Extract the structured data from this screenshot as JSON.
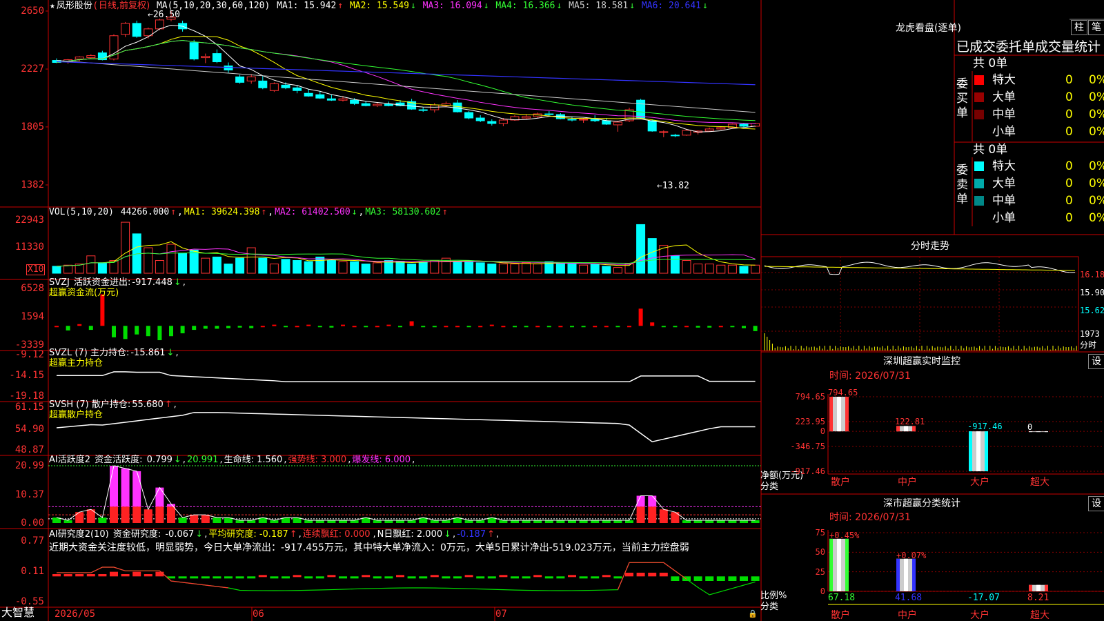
{
  "chart_data": [
    {
      "type": "candlestick",
      "title": "凤形股份",
      "period": "日线,前复权",
      "y_ticks": [
        "2650",
        "2227",
        "1805",
        "1382"
      ],
      "ylim": [
        1382,
        2650
      ],
      "annotations": [
        {
          "text": "26.50"
        },
        {
          "text": "←13.82"
        }
      ],
      "ma_header": {
        "label": "MA(5,10,20,30,60,120)",
        "items": [
          {
            "name": "MA1",
            "value": "15.942",
            "trend": "↑",
            "color": "#ffffff"
          },
          {
            "name": "MA2",
            "value": "15.549",
            "trend": "↓",
            "color": "#ffff00"
          },
          {
            "name": "MA3",
            "value": "16.094",
            "trend": "↓",
            "color": "#ff33ff"
          },
          {
            "name": "MA4",
            "value": "16.366",
            "trend": "↓",
            "color": "#33ff33"
          },
          {
            "name": "MA5",
            "value": "18.581",
            "trend": "↓",
            "color": "#cccccc"
          },
          {
            "name": "MA6",
            "value": "20.641",
            "trend": "↓",
            "color": "#3333ff"
          }
        ]
      },
      "candles": [
        {
          "o": 2290,
          "h": 2305,
          "l": 2270,
          "c": 2275
        },
        {
          "o": 2280,
          "h": 2300,
          "l": 2265,
          "c": 2295
        },
        {
          "o": 2300,
          "h": 2320,
          "l": 2285,
          "c": 2315
        },
        {
          "o": 2310,
          "h": 2335,
          "l": 2300,
          "c": 2325
        },
        {
          "o": 2345,
          "h": 2360,
          "l": 2290,
          "c": 2295
        },
        {
          "o": 2300,
          "h": 2480,
          "l": 2290,
          "c": 2470
        },
        {
          "o": 2480,
          "h": 2570,
          "l": 2460,
          "c": 2560
        },
        {
          "o": 2560,
          "h": 2580,
          "l": 2455,
          "c": 2465
        },
        {
          "o": 2470,
          "h": 2530,
          "l": 2450,
          "c": 2520
        },
        {
          "o": 2520,
          "h": 2595,
          "l": 2510,
          "c": 2585
        },
        {
          "o": 2590,
          "h": 2650,
          "l": 2575,
          "c": 2605
        },
        {
          "o": 2560,
          "h": 2580,
          "l": 2500,
          "c": 2520
        },
        {
          "o": 2420,
          "h": 2440,
          "l": 2290,
          "c": 2300
        },
        {
          "o": 2310,
          "h": 2340,
          "l": 2270,
          "c": 2320
        },
        {
          "o": 2340,
          "h": 2370,
          "l": 2270,
          "c": 2280
        },
        {
          "o": 2250,
          "h": 2275,
          "l": 2200,
          "c": 2220
        },
        {
          "o": 2170,
          "h": 2185,
          "l": 2120,
          "c": 2130
        },
        {
          "o": 2140,
          "h": 2190,
          "l": 2120,
          "c": 2170
        },
        {
          "o": 2140,
          "h": 2180,
          "l": 2080,
          "c": 2090
        },
        {
          "o": 2070,
          "h": 2130,
          "l": 2060,
          "c": 2120
        },
        {
          "o": 2110,
          "h": 2130,
          "l": 2080,
          "c": 2090
        },
        {
          "o": 2090,
          "h": 2110,
          "l": 2050,
          "c": 2070
        },
        {
          "o": 2050,
          "h": 2080,
          "l": 2025,
          "c": 2030
        },
        {
          "o": 2040,
          "h": 2065,
          "l": 2010,
          "c": 2015
        },
        {
          "o": 2010,
          "h": 2040,
          "l": 1995,
          "c": 2000
        },
        {
          "o": 2000,
          "h": 2030,
          "l": 1990,
          "c": 2010
        },
        {
          "o": 2000,
          "h": 2015,
          "l": 1965,
          "c": 1975
        },
        {
          "o": 1975,
          "h": 1995,
          "l": 1955,
          "c": 1960
        },
        {
          "o": 1960,
          "h": 1985,
          "l": 1950,
          "c": 1970
        },
        {
          "o": 1970,
          "h": 1990,
          "l": 1955,
          "c": 1960
        },
        {
          "o": 1980,
          "h": 2000,
          "l": 1955,
          "c": 1960
        },
        {
          "o": 1990,
          "h": 2010,
          "l": 1930,
          "c": 1935
        },
        {
          "o": 1930,
          "h": 1950,
          "l": 1915,
          "c": 1925
        },
        {
          "o": 1930,
          "h": 1980,
          "l": 1910,
          "c": 1965
        },
        {
          "o": 1960,
          "h": 1990,
          "l": 1950,
          "c": 1975
        },
        {
          "o": 1980,
          "h": 2000,
          "l": 1910,
          "c": 1915
        },
        {
          "o": 1910,
          "h": 1920,
          "l": 1860,
          "c": 1870
        },
        {
          "o": 1870,
          "h": 1890,
          "l": 1840,
          "c": 1850
        },
        {
          "o": 1845,
          "h": 1860,
          "l": 1815,
          "c": 1830
        },
        {
          "o": 1830,
          "h": 1870,
          "l": 1810,
          "c": 1855
        },
        {
          "o": 1855,
          "h": 1890,
          "l": 1850,
          "c": 1880
        },
        {
          "o": 1870,
          "h": 1900,
          "l": 1865,
          "c": 1880
        },
        {
          "o": 1880,
          "h": 1910,
          "l": 1870,
          "c": 1900
        },
        {
          "o": 1900,
          "h": 1920,
          "l": 1880,
          "c": 1895
        },
        {
          "o": 1895,
          "h": 1905,
          "l": 1860,
          "c": 1865
        },
        {
          "o": 1860,
          "h": 1880,
          "l": 1845,
          "c": 1855
        },
        {
          "o": 1855,
          "h": 1870,
          "l": 1835,
          "c": 1860
        },
        {
          "o": 1860,
          "h": 1890,
          "l": 1840,
          "c": 1850
        },
        {
          "o": 1850,
          "h": 1870,
          "l": 1820,
          "c": 1825
        },
        {
          "o": 1820,
          "h": 1850,
          "l": 1770,
          "c": 1840
        },
        {
          "o": 1850,
          "h": 1945,
          "l": 1840,
          "c": 1930
        },
        {
          "o": 2000,
          "h": 2010,
          "l": 1860,
          "c": 1870
        },
        {
          "o": 1850,
          "h": 1860,
          "l": 1770,
          "c": 1775
        },
        {
          "o": 1770,
          "h": 1780,
          "l": 1730,
          "c": 1770
        },
        {
          "o": 1745,
          "h": 1755,
          "l": 1730,
          "c": 1740
        },
        {
          "o": 1745,
          "h": 1790,
          "l": 1740,
          "c": 1780
        },
        {
          "o": 1765,
          "h": 1780,
          "l": 1750,
          "c": 1775
        },
        {
          "o": 1775,
          "h": 1800,
          "l": 1770,
          "c": 1790
        },
        {
          "o": 1790,
          "h": 1810,
          "l": 1785,
          "c": 1800
        },
        {
          "o": 1800,
          "h": 1830,
          "l": 1795,
          "c": 1825
        },
        {
          "o": 1825,
          "h": 1835,
          "l": 1800,
          "c": 1810
        },
        {
          "o": 1810,
          "h": 1835,
          "l": 1805,
          "c": 1830
        }
      ]
    },
    {
      "type": "bar",
      "title": "VOL(5,10,20)",
      "value": "44266.000",
      "value_trend": "↑",
      "items": [
        {
          "name": "MA1",
          "value": "39624.398",
          "trend": "↑",
          "color": "#ffff00"
        },
        {
          "name": "MA2",
          "value": "61402.500",
          "trend": "↓",
          "color": "#ff33ff"
        },
        {
          "name": "MA3",
          "value": "58130.602",
          "trend": "↑",
          "color": "#33ff33"
        }
      ],
      "y_ticks": [
        "22943",
        "11330"
      ],
      "unit": "X10",
      "ylim": [
        0,
        25000
      ],
      "values": [
        3000,
        3500,
        4000,
        7500,
        4500,
        5500,
        22000,
        17000,
        11000,
        5500,
        12500,
        8500,
        10000,
        6500,
        7000,
        4000,
        6500,
        11000,
        6500,
        4000,
        6000,
        5500,
        5000,
        7000,
        5500,
        5000,
        5000,
        4000,
        4500,
        5500,
        5000,
        4000,
        5000,
        5500,
        6500,
        5000,
        5000,
        4500,
        4000,
        4000,
        4000,
        4500,
        4000,
        5000,
        4000,
        4000,
        3500,
        4000,
        3000,
        2500,
        4000,
        21000,
        15000,
        12000,
        7500,
        5500,
        4000,
        4000,
        3500,
        3500,
        3000,
        3500
      ]
    },
    {
      "type": "bar",
      "title": "SVZJ",
      "subtitle": "活跃资金进出:",
      "value": "-917.448",
      "value_trend": "↓",
      "label2": "超赢资金流(万元)",
      "y_ticks": [
        "6528",
        "1594",
        "-3339"
      ],
      "ylim": [
        -3339,
        6528
      ],
      "values": [
        0,
        -800,
        300,
        -700,
        5500,
        -2000,
        -2300,
        -1500,
        -1800,
        -2500,
        -1800,
        -1300,
        -700,
        -500,
        -500,
        -400,
        -300,
        -400,
        0,
        200,
        -200,
        0,
        200,
        -200,
        -300,
        200,
        0,
        -200,
        0,
        200,
        -200,
        800,
        -200,
        -200,
        0,
        0,
        -200,
        0,
        200,
        0,
        -200,
        -200,
        0,
        -200,
        0,
        -200,
        -200,
        0,
        0,
        -200,
        0,
        3000,
        600,
        -200,
        -200,
        0,
        -300,
        -300,
        0,
        -200,
        -400,
        -917
      ]
    },
    {
      "type": "line",
      "title": "SVZL (7) 主力持仓:",
      "value": "-15.861",
      "value_trend": "↓",
      "label2": "超赢主力持仓",
      "y_ticks": [
        "-9.12",
        "-14.15",
        "-19.18"
      ],
      "ylim": [
        -19.18,
        -9.12
      ]
    },
    {
      "type": "line",
      "title": "SVSH (7) 散户持仓:",
      "value": "55.680",
      "value_trend": "↑",
      "label2": "超赢散户持仓",
      "y_ticks": [
        "61.15",
        "54.90",
        "48.87"
      ],
      "ylim": [
        48.87,
        61.15
      ]
    },
    {
      "type": "bar",
      "title": "AI活跃度2",
      "subtitle": "资金活跃度:",
      "value": "0.799",
      "value_trend": "↓",
      "items": [
        {
          "name": "",
          "value": "20.991",
          "trend": "",
          "color": "#33ff33"
        },
        {
          "name": "生命线",
          "value": "1.560",
          "trend": "",
          "color": "#ffffff"
        },
        {
          "name": "强势线",
          "value": "3.000",
          "trend": "",
          "color": "#ff3333"
        },
        {
          "name": "爆发线",
          "value": "6.000",
          "trend": "",
          "color": "#ff33ff"
        }
      ],
      "y_ticks": [
        "20.99",
        "10.37",
        "0.00"
      ],
      "ylim": [
        0,
        20.99
      ],
      "values": [
        2,
        1,
        4,
        5,
        2,
        21,
        20,
        19,
        5,
        13,
        7,
        2,
        3,
        3,
        2,
        2,
        1,
        1,
        2,
        1,
        2,
        2,
        1,
        1,
        1,
        1,
        1,
        2,
        1,
        1,
        1,
        1,
        2,
        1,
        1,
        2,
        1,
        1,
        2,
        1,
        1,
        1,
        1,
        1,
        1,
        1,
        1,
        1,
        1,
        1,
        1,
        10,
        10,
        5,
        4,
        1,
        1,
        1,
        1,
        1,
        1,
        1
      ]
    },
    {
      "type": "bar",
      "title": "AI研究度2(10)",
      "subtitle": "资金研究度:",
      "value": "-0.067",
      "value_trend": "↓",
      "items": [
        {
          "name": "平均研究度",
          "value": "-0.187",
          "trend": "↑",
          "color": "#ffff00"
        },
        {
          "name": "连续飘红",
          "value": "0.000",
          "trend": "",
          "color": "#ff3333"
        },
        {
          "name": "N日飘红",
          "value": "2.000",
          "trend": "↓",
          "color": "#ffffff"
        },
        {
          "name": "",
          "value": "-0.187",
          "trend": "↑",
          "color": "#3333ff"
        }
      ],
      "note": "近期大资金关注度较低，明显弱势，今日大单净流出：-917.455万元，其中特大单净流入：0万元，大单5日累计净出-519.023万元，当前主力控盘弱",
      "y_ticks": [
        "0.77",
        "0.11",
        "-0.55"
      ],
      "ylim": [
        -0.55,
        0.77
      ]
    }
  ],
  "xaxis": {
    "labels": [
      "2026/05",
      "06",
      "07"
    ]
  },
  "bottom_left": "大智慧",
  "right_panel": {
    "lhb": {
      "title": "龙虎看盘(逐单)",
      "btn1": "柱",
      "btn2": "笔",
      "header": "已成交委托单成交量统计",
      "buy": {
        "side_label": "委买单",
        "total": "共 0单",
        "rows": [
          {
            "label": "特大",
            "count": "0",
            "pct": "0%",
            "color": "#ff0000"
          },
          {
            "label": "大单",
            "count": "0",
            "pct": "0%",
            "color": "#990000"
          },
          {
            "label": "中单",
            "count": "0",
            "pct": "0%",
            "color": "#770000"
          },
          {
            "label": "小单",
            "count": "0",
            "pct": "0%",
            "color": ""
          }
        ]
      },
      "sell": {
        "side_label": "委卖单",
        "total": "共 0单",
        "rows": [
          {
            "label": "特大",
            "count": "0",
            "pct": "0%",
            "color": "#00ffff"
          },
          {
            "label": "大单",
            "count": "0",
            "pct": "0%",
            "color": "#00aaaa"
          },
          {
            "label": "中单",
            "count": "0",
            "pct": "0%",
            "color": "#008888"
          },
          {
            "label": "小单",
            "count": "0",
            "pct": "0%",
            "color": ""
          }
        ]
      }
    },
    "fenshi": {
      "title": "分时走势",
      "y_ticks": [
        "16.18",
        "15.90",
        "15.62",
        "1973",
        "分时"
      ]
    },
    "monitor": {
      "title": "深圳超赢实时监控",
      "btn": "设",
      "time": "时间: 2026/07/31",
      "y_ticks": [
        "794.65",
        "223.95",
        "0",
        "-346.75",
        "-917.46"
      ],
      "ylim": [
        -917.46,
        794.65
      ],
      "bars": [
        {
          "category": "散户",
          "value": 794.65,
          "label": "794.65",
          "color": "#ff3333"
        },
        {
          "category": "中户",
          "value": 122.81,
          "label": "122.81",
          "color": "#ff3333"
        },
        {
          "category": "大户",
          "value": -917.46,
          "label": "-917.46",
          "color": "#00ffff"
        },
        {
          "category": "超大",
          "value": 0,
          "label": "0",
          "color": "#ffffff"
        }
      ],
      "ylabel": "净额(万元)",
      "xlabel": "分类"
    },
    "stats": {
      "title": "深市超赢分类统计",
      "btn": "设",
      "time": "时间: 2026/07/31",
      "y_ticks": [
        "75",
        "50",
        "25",
        "0"
      ],
      "ylim": [
        0,
        75
      ],
      "bars": [
        {
          "category": "散户",
          "value": 67.18,
          "label": "67.18",
          "top_label": "+0.45%",
          "color": "#33ff33"
        },
        {
          "category": "中户",
          "value": 41.68,
          "label": "41.68",
          "top_label": "+0.07%",
          "color": "#3333ff"
        },
        {
          "category": "大户",
          "value": -17.07,
          "label": "-17.07",
          "top_label": "",
          "color": "#00ffff"
        },
        {
          "category": "超大",
          "value": 8.21,
          "label": "8.21",
          "top_label": "",
          "color": "#ff3333"
        }
      ],
      "ylabel": "比例%",
      "xlabel": "分类"
    }
  }
}
